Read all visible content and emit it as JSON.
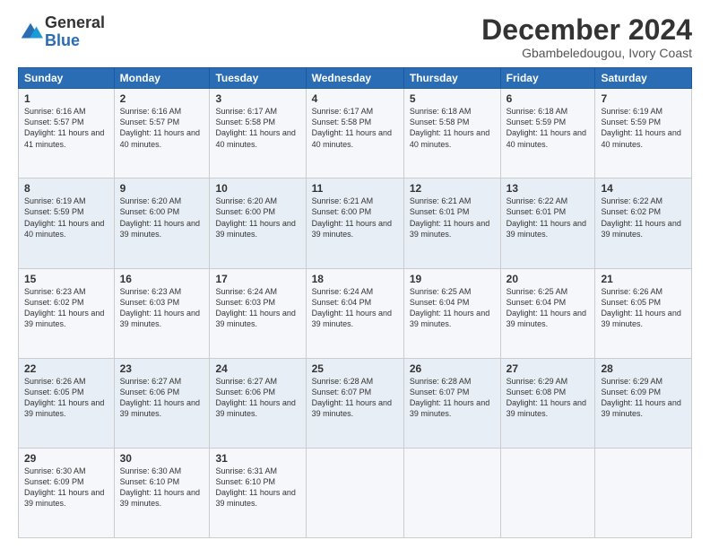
{
  "logo": {
    "general": "General",
    "blue": "Blue"
  },
  "header": {
    "title": "December 2024",
    "subtitle": "Gbambeledougou, Ivory Coast"
  },
  "weekdays": [
    "Sunday",
    "Monday",
    "Tuesday",
    "Wednesday",
    "Thursday",
    "Friday",
    "Saturday"
  ],
  "weeks": [
    [
      {
        "day": "1",
        "rise": "6:16 AM",
        "set": "5:57 PM",
        "daylight": "11 hours and 41 minutes."
      },
      {
        "day": "2",
        "rise": "6:16 AM",
        "set": "5:57 PM",
        "daylight": "11 hours and 40 minutes."
      },
      {
        "day": "3",
        "rise": "6:17 AM",
        "set": "5:58 PM",
        "daylight": "11 hours and 40 minutes."
      },
      {
        "day": "4",
        "rise": "6:17 AM",
        "set": "5:58 PM",
        "daylight": "11 hours and 40 minutes."
      },
      {
        "day": "5",
        "rise": "6:18 AM",
        "set": "5:58 PM",
        "daylight": "11 hours and 40 minutes."
      },
      {
        "day": "6",
        "rise": "6:18 AM",
        "set": "5:59 PM",
        "daylight": "11 hours and 40 minutes."
      },
      {
        "day": "7",
        "rise": "6:19 AM",
        "set": "5:59 PM",
        "daylight": "11 hours and 40 minutes."
      }
    ],
    [
      {
        "day": "8",
        "rise": "6:19 AM",
        "set": "5:59 PM",
        "daylight": "11 hours and 40 minutes."
      },
      {
        "day": "9",
        "rise": "6:20 AM",
        "set": "6:00 PM",
        "daylight": "11 hours and 39 minutes."
      },
      {
        "day": "10",
        "rise": "6:20 AM",
        "set": "6:00 PM",
        "daylight": "11 hours and 39 minutes."
      },
      {
        "day": "11",
        "rise": "6:21 AM",
        "set": "6:00 PM",
        "daylight": "11 hours and 39 minutes."
      },
      {
        "day": "12",
        "rise": "6:21 AM",
        "set": "6:01 PM",
        "daylight": "11 hours and 39 minutes."
      },
      {
        "day": "13",
        "rise": "6:22 AM",
        "set": "6:01 PM",
        "daylight": "11 hours and 39 minutes."
      },
      {
        "day": "14",
        "rise": "6:22 AM",
        "set": "6:02 PM",
        "daylight": "11 hours and 39 minutes."
      }
    ],
    [
      {
        "day": "15",
        "rise": "6:23 AM",
        "set": "6:02 PM",
        "daylight": "11 hours and 39 minutes."
      },
      {
        "day": "16",
        "rise": "6:23 AM",
        "set": "6:03 PM",
        "daylight": "11 hours and 39 minutes."
      },
      {
        "day": "17",
        "rise": "6:24 AM",
        "set": "6:03 PM",
        "daylight": "11 hours and 39 minutes."
      },
      {
        "day": "18",
        "rise": "6:24 AM",
        "set": "6:04 PM",
        "daylight": "11 hours and 39 minutes."
      },
      {
        "day": "19",
        "rise": "6:25 AM",
        "set": "6:04 PM",
        "daylight": "11 hours and 39 minutes."
      },
      {
        "day": "20",
        "rise": "6:25 AM",
        "set": "6:04 PM",
        "daylight": "11 hours and 39 minutes."
      },
      {
        "day": "21",
        "rise": "6:26 AM",
        "set": "6:05 PM",
        "daylight": "11 hours and 39 minutes."
      }
    ],
    [
      {
        "day": "22",
        "rise": "6:26 AM",
        "set": "6:05 PM",
        "daylight": "11 hours and 39 minutes."
      },
      {
        "day": "23",
        "rise": "6:27 AM",
        "set": "6:06 PM",
        "daylight": "11 hours and 39 minutes."
      },
      {
        "day": "24",
        "rise": "6:27 AM",
        "set": "6:06 PM",
        "daylight": "11 hours and 39 minutes."
      },
      {
        "day": "25",
        "rise": "6:28 AM",
        "set": "6:07 PM",
        "daylight": "11 hours and 39 minutes."
      },
      {
        "day": "26",
        "rise": "6:28 AM",
        "set": "6:07 PM",
        "daylight": "11 hours and 39 minutes."
      },
      {
        "day": "27",
        "rise": "6:29 AM",
        "set": "6:08 PM",
        "daylight": "11 hours and 39 minutes."
      },
      {
        "day": "28",
        "rise": "6:29 AM",
        "set": "6:09 PM",
        "daylight": "11 hours and 39 minutes."
      }
    ],
    [
      {
        "day": "29",
        "rise": "6:30 AM",
        "set": "6:09 PM",
        "daylight": "11 hours and 39 minutes."
      },
      {
        "day": "30",
        "rise": "6:30 AM",
        "set": "6:10 PM",
        "daylight": "11 hours and 39 minutes."
      },
      {
        "day": "31",
        "rise": "6:31 AM",
        "set": "6:10 PM",
        "daylight": "11 hours and 39 minutes."
      },
      null,
      null,
      null,
      null
    ]
  ]
}
